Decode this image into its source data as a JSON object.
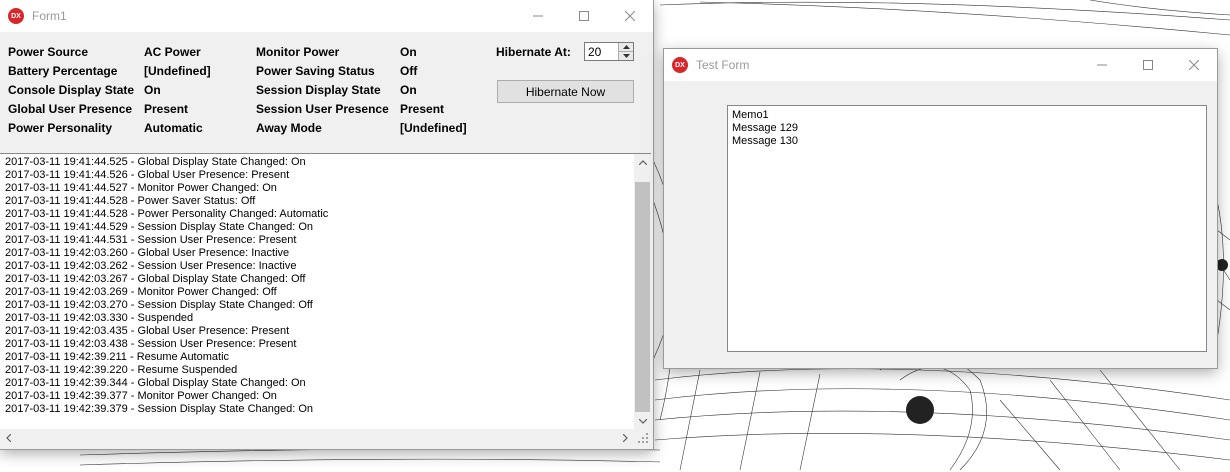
{
  "form1": {
    "title": "Form1",
    "icon": "dx-app-icon",
    "status": [
      {
        "label": "Power Source",
        "value": "AC Power"
      },
      {
        "label": "Battery Percentage",
        "value": "[Undefined]"
      },
      {
        "label": "Console Display State",
        "value": "On"
      },
      {
        "label": "Global User Presence",
        "value": "Present"
      },
      {
        "label": "Power Personality",
        "value": "Automatic"
      }
    ],
    "status2": [
      {
        "label": "Monitor Power",
        "value": "On"
      },
      {
        "label": "Power Saving Status",
        "value": "Off"
      },
      {
        "label": "Session Display State",
        "value": "On"
      },
      {
        "label": "Session User Presence",
        "value": "Present"
      },
      {
        "label": "Away Mode",
        "value": "[Undefined]"
      }
    ],
    "hibernate_label": "Hibernate At:",
    "hibernate_value": "20",
    "hibernate_button": "Hibernate Now",
    "log": [
      "2017-03-11 19:41:44.525 - Global Display State Changed: On",
      "2017-03-11 19:41:44.526 - Global User Presence: Present",
      "2017-03-11 19:41:44.527 - Monitor Power Changed: On",
      "2017-03-11 19:41:44.528 - Power Saver Status: Off",
      "2017-03-11 19:41:44.528 - Power Personality Changed: Automatic",
      "2017-03-11 19:41:44.529 - Session Display State Changed: On",
      "2017-03-11 19:41:44.531 - Session User Presence: Present",
      "2017-03-11 19:42:03.260 - Global User Presence: Inactive",
      "2017-03-11 19:42:03.262 - Session User Presence: Inactive",
      "2017-03-11 19:42:03.267 - Global Display State Changed: Off",
      "2017-03-11 19:42:03.269 - Monitor Power Changed: Off",
      "2017-03-11 19:42:03.270 - Session Display State Changed: Off",
      "2017-03-11 19:42:03.330 - Suspended",
      "2017-03-11 19:42:03.435 - Global User Presence: Present",
      "2017-03-11 19:42:03.438 - Session User Presence: Present",
      "2017-03-11 19:42:39.211 - Resume Automatic",
      "2017-03-11 19:42:39.220 - Resume Suspended",
      "2017-03-11 19:42:39.344 - Global Display State Changed: On",
      "2017-03-11 19:42:39.377 - Monitor Power Changed: On",
      "2017-03-11 19:42:39.379 - Session Display State Changed: On"
    ]
  },
  "testform": {
    "title": "Test Form",
    "icon": "dx-app-icon",
    "memo": [
      "Memo1",
      "Message 129",
      "Message 130"
    ]
  },
  "colors": {
    "icon_red": "#d8262b",
    "title_text": "#9a9a9a",
    "window_bg": "#f0f0f0"
  }
}
